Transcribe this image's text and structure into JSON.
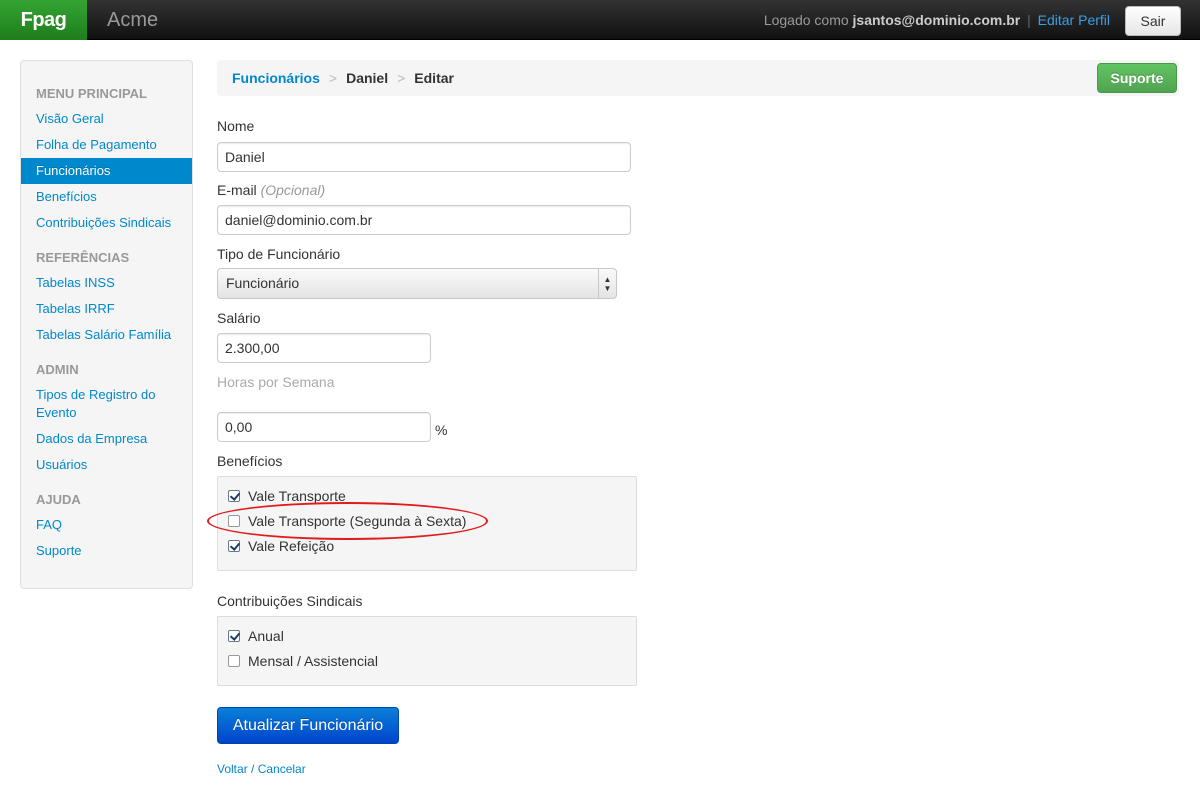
{
  "topbar": {
    "brand": "Fpag",
    "company": "Acme",
    "logged_prefix": "Logado como",
    "user_email": "jsantos@dominio.com.br",
    "separator": "|",
    "edit_profile": "Editar Perfil",
    "logout": "Sair"
  },
  "sidebar": {
    "sections": [
      {
        "header": "MENU PRINCIPAL",
        "items": [
          "Visão Geral",
          "Folha de Pagamento",
          "Funcionários",
          "Benefícios",
          "Contribuições Sindicais"
        ]
      },
      {
        "header": "REFERÊNCIAS",
        "items": [
          "Tabelas INSS",
          "Tabelas IRRF",
          "Tabelas Salário Família"
        ]
      },
      {
        "header": "ADMIN",
        "items": [
          "Tipos de Registro do Evento",
          "Dados da Empresa",
          "Usuários"
        ]
      },
      {
        "header": "AJUDA",
        "items": [
          "FAQ",
          "Suporte"
        ]
      }
    ],
    "active_item": "Funcionários"
  },
  "breadcrumb": {
    "root": "Funcionários",
    "divider": ">",
    "name": "Daniel",
    "action": "Editar",
    "support_button": "Suporte"
  },
  "form": {
    "name_label": "Nome",
    "name_value": "Daniel",
    "email_label": "E-mail",
    "email_optional": "(Opcional)",
    "email_value": "daniel@dominio.com.br",
    "type_label": "Tipo de Funcionário",
    "type_value": "Funcionário",
    "salary_label": "Salário",
    "salary_value": "2.300,00",
    "hours_label": "Horas por Semana",
    "pct_value": "0,00",
    "pct_symbol": "%",
    "benefits_label": "Benefícios",
    "benefits": [
      {
        "label": "Vale Transporte",
        "checked": true
      },
      {
        "label": "Vale Transporte (Segunda à Sexta)",
        "checked": false
      },
      {
        "label": "Vale Refeição",
        "checked": true
      }
    ],
    "union_label": "Contribuições Sindicais",
    "union": [
      {
        "label": "Anual",
        "checked": true
      },
      {
        "label": "Mensal / Assistencial",
        "checked": false
      }
    ],
    "submit": "Atualizar Funcionário",
    "cancel": "Voltar / Cancelar"
  },
  "colors": {
    "brand_green": "#34a432",
    "link_blue": "#0088cc",
    "primary_blue": "#0044cc",
    "annotation_red": "#e01b1b"
  }
}
